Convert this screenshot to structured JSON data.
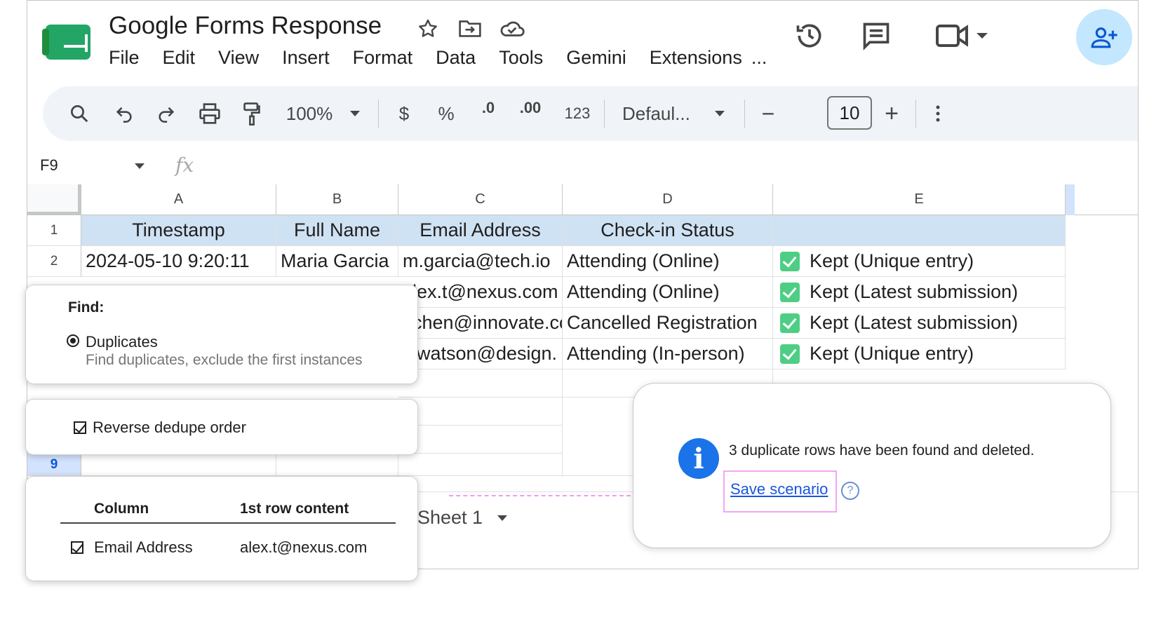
{
  "header": {
    "title": "Google Forms Response",
    "menu": [
      "File",
      "Edit",
      "View",
      "Insert",
      "Format",
      "Data",
      "Tools",
      "Gemini",
      "Extensions",
      "..."
    ]
  },
  "toolbar": {
    "zoom": "100%",
    "currency": "$",
    "percent": "%",
    "decrease_decimal": ".0",
    "increase_decimal": ".00",
    "number_format": "123",
    "font": "Defaul...",
    "font_size": "10",
    "minus": "−",
    "plus": "+"
  },
  "formula_bar": {
    "cell_ref": "F9",
    "fx": "fx"
  },
  "grid": {
    "columns": [
      "A",
      "B",
      "C",
      "D",
      "E"
    ],
    "row_numbers": [
      "1",
      "2",
      "9"
    ],
    "header_row": [
      "Timestamp",
      "Full Name",
      "Email Address",
      "Check-in Status",
      ""
    ],
    "rows": [
      [
        "2024-05-10 9:20:11",
        "Maria Garcia",
        "m.garcia@tech.io",
        "Attending (Online)",
        "Kept (Unique entry)"
      ],
      [
        "",
        "",
        "lex.t@nexus.com",
        "Attending (Online)",
        "Kept (Latest submission)"
      ],
      [
        "",
        "",
        "chen@innovate.co",
        "Cancelled Registration",
        "Kept (Latest submission)"
      ],
      [
        "",
        "",
        "watson@design.",
        "Attending (In-person)",
        "Kept (Unique entry)"
      ]
    ],
    "sheet_tab": "Sheet 1"
  },
  "find_panel": {
    "label": "Find:",
    "option": "Duplicates",
    "option_desc": "Find duplicates, exclude the first instances"
  },
  "reverse_panel": {
    "label": "Reverse dedupe order"
  },
  "columns_panel": {
    "col_header": "Column",
    "content_header": "1st row content",
    "column": "Email Address",
    "content": "alex.t@nexus.com"
  },
  "result": {
    "message": "3 duplicate rows have been found and deleted.",
    "link": "Save scenario",
    "help": "?"
  },
  "colors": {
    "header_fill": "#cfe2f3",
    "check_green": "#4ece85",
    "link_blue": "#1a56db",
    "highlight_pink": "#f2a6f2"
  }
}
